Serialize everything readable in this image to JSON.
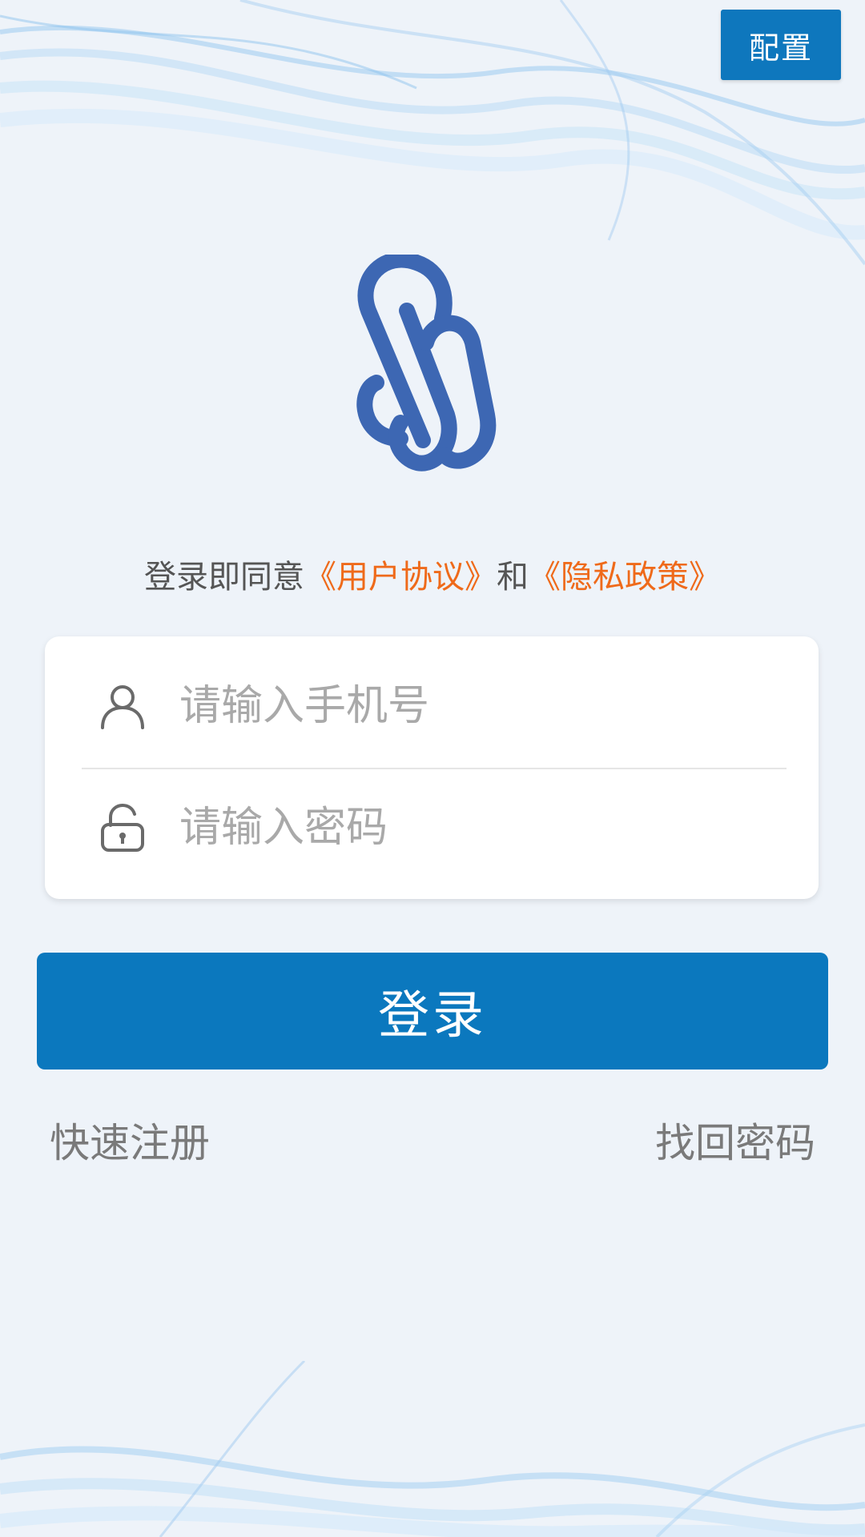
{
  "header": {
    "config_label": "配置"
  },
  "agreement": {
    "prefix": "登录即同意",
    "user_agreement": "《用户协议》",
    "and": "和",
    "privacy_policy": "《隐私政策》"
  },
  "form": {
    "phone_placeholder": "请输入手机号",
    "password_placeholder": "请输入密码",
    "login_label": "登录"
  },
  "footer_links": {
    "register": "快速注册",
    "forgot_password": "找回密码"
  },
  "icons": {
    "logo": "paperclip-s-logo",
    "phone": "user-icon",
    "password": "lock-icon"
  },
  "colors": {
    "accent": "#0b78be",
    "link": "#ef6a1a",
    "logo": "#3d67b3"
  }
}
